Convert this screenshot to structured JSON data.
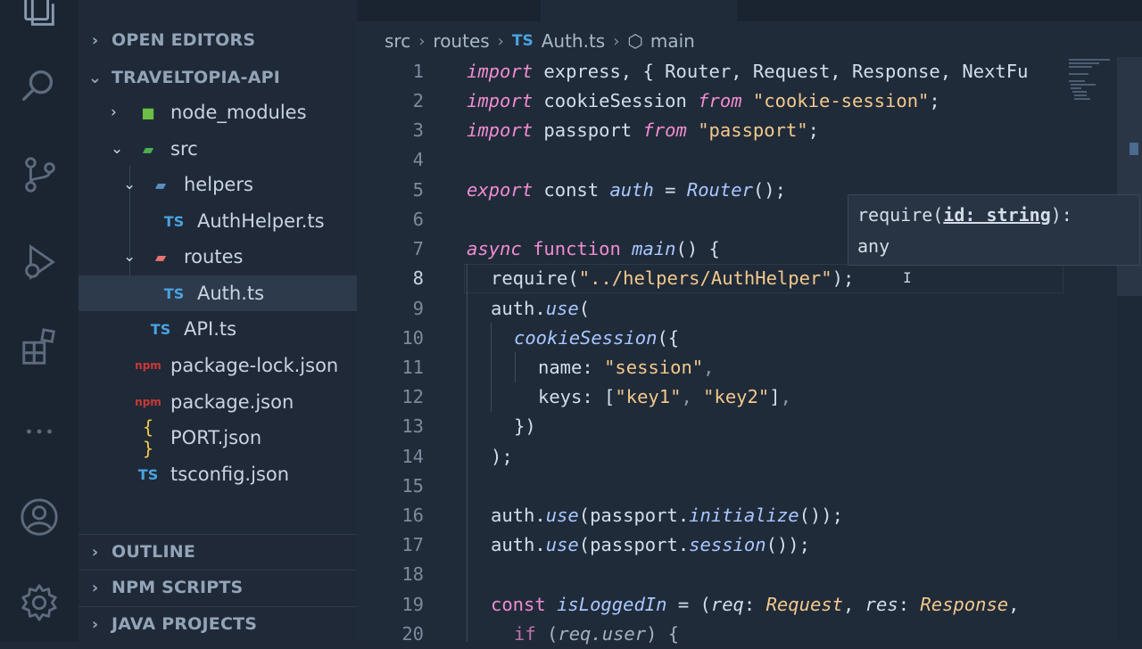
{
  "sidebar": {
    "sections": {
      "open_editors": "OPEN EDITORS",
      "project": "TRAVELTOPIA-API",
      "outline": "OUTLINE",
      "npm_scripts": "NPM SCRIPTS",
      "java_projects": "JAVA PROJECTS"
    },
    "tree": {
      "node_modules": "node_modules",
      "src": "src",
      "helpers": "helpers",
      "auth_helper": "AuthHelper.ts",
      "routes": "routes",
      "auth": "Auth.ts",
      "api": "API.ts",
      "package_lock": "package-lock.json",
      "package": "package.json",
      "port": "PORT.json",
      "tsconfig": "tsconfig.json"
    },
    "icons": {
      "ts": "TS",
      "npm": "npm",
      "braces": "{ }"
    }
  },
  "breadcrumb": {
    "src": "src",
    "routes": "routes",
    "file_badge": "TS",
    "file": "Auth.ts",
    "symbol": "main"
  },
  "code": {
    "line_numbers": [
      "1",
      "2",
      "3",
      "4",
      "5",
      "6",
      "7",
      "8",
      "9",
      "10",
      "11",
      "12",
      "13",
      "14",
      "15",
      "16",
      "17",
      "18",
      "19",
      "20"
    ],
    "l1": {
      "kw": "import",
      "rest": " express, { Router, Request, Response, NextFu"
    },
    "l2": {
      "kw": "import",
      "a": " cookieSession ",
      "kw2": "from",
      "b": " ",
      "str": "\"cookie-session\"",
      "c": ";"
    },
    "l3": {
      "kw": "import",
      "a": " passport ",
      "kw2": "from",
      "b": " ",
      "str": "\"passport\"",
      "c": ";"
    },
    "l5": {
      "kw": "export",
      "a": " const ",
      "id": "auth",
      "b": " = ",
      "fn": "Router",
      "c": "();"
    },
    "l7": {
      "kw": "async",
      "a": " ",
      "kw2": "function",
      "b": " ",
      "fn": "main",
      "c": "() {"
    },
    "l8": {
      "fn": "require",
      "a": "(",
      "str": "\"../helpers/AuthHelper\"",
      "b": ");"
    },
    "l9": {
      "a": "auth.",
      "m": "use",
      "b": "("
    },
    "l10": {
      "fn": "cookieSession",
      "a": "({"
    },
    "l11": {
      "a": "name: ",
      "str": "\"session\"",
      "b": ","
    },
    "l12": {
      "a": "keys: [",
      "s1": "\"key1\"",
      "b": ", ",
      "s2": "\"key2\"",
      "c": "]",
      "d": ","
    },
    "l13": {
      "a": "})"
    },
    "l14": {
      "a": ");"
    },
    "l16": {
      "a": "auth.",
      "m": "use",
      "b": "(passport.",
      "m2": "initialize",
      "c": "());"
    },
    "l17": {
      "a": "auth.",
      "m": "use",
      "b": "(passport.",
      "m2": "session",
      "c": "());"
    },
    "l19": {
      "kw": "const",
      "a": " ",
      "fn": "isLoggedIn",
      "b": " = (",
      "p1": "req",
      "c": ": ",
      "t1": "Request",
      "d": ", ",
      "p2": "res",
      "e": ": ",
      "t2": "Response",
      "f": ","
    },
    "l20": {
      "kw": "if",
      "a": " (",
      "p": "req.user",
      "b": ") {"
    }
  },
  "hover": {
    "fn": "require(",
    "param": "id: string",
    "close": "):",
    "returns": "any"
  },
  "colors": {
    "keyword": "#f08cd0",
    "string": "#f3c98b",
    "function": "#a9c7ff",
    "ts_blue": "#4aa3e0",
    "npm_red": "#cb3837"
  }
}
